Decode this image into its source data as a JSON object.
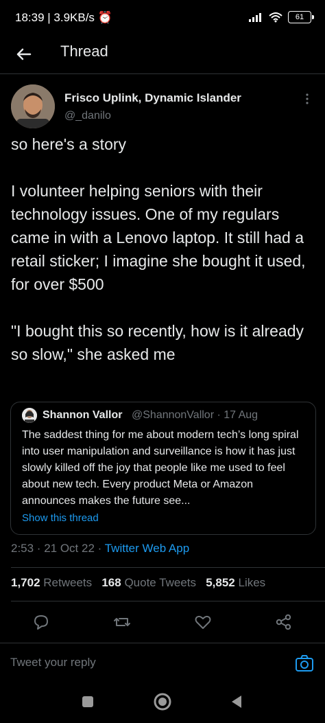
{
  "status_bar": {
    "left": "18:39 | 3.9KB/s ⏰",
    "battery": "61"
  },
  "header": {
    "title": "Thread"
  },
  "tweet": {
    "author_name": "Frisco Uplink, Dynamic Islander",
    "author_handle": "@_danilo",
    "text": "so here's a story\n\nI volunteer helping seniors with their technology issues. One of my regulars came in with a Lenovo laptop. It still had a retail sticker; I imagine she bought it used, for over $500\n\n\"I bought this so recently, how is it already so slow,\" she asked me",
    "time": "2:53 · 21 Oct 22 · ",
    "app": "Twitter Web App"
  },
  "quote": {
    "name": "Shannon Vallor",
    "handle_date": "@ShannonVallor · 17 Aug",
    "text": "The saddest thing for me about modern tech’s long spiral into user manipulation and surveillance is how it has just slowly killed off the joy that people like me used to feel about new tech. Every product Meta or Amazon announces makes the future see...",
    "show_thread": "Show this thread"
  },
  "stats": {
    "retweets_count": "1,702",
    "retweets_label": "Retweets",
    "quotes_count": "168",
    "quotes_label": "Quote Tweets",
    "likes_count": "5,852",
    "likes_label": "Likes"
  },
  "reply": {
    "placeholder": "Tweet your reply"
  },
  "colors": {
    "background": "#000000",
    "text": "#e7e9ea",
    "secondary": "#71767b",
    "accent": "#1d9bf0",
    "border": "#2f3336"
  }
}
